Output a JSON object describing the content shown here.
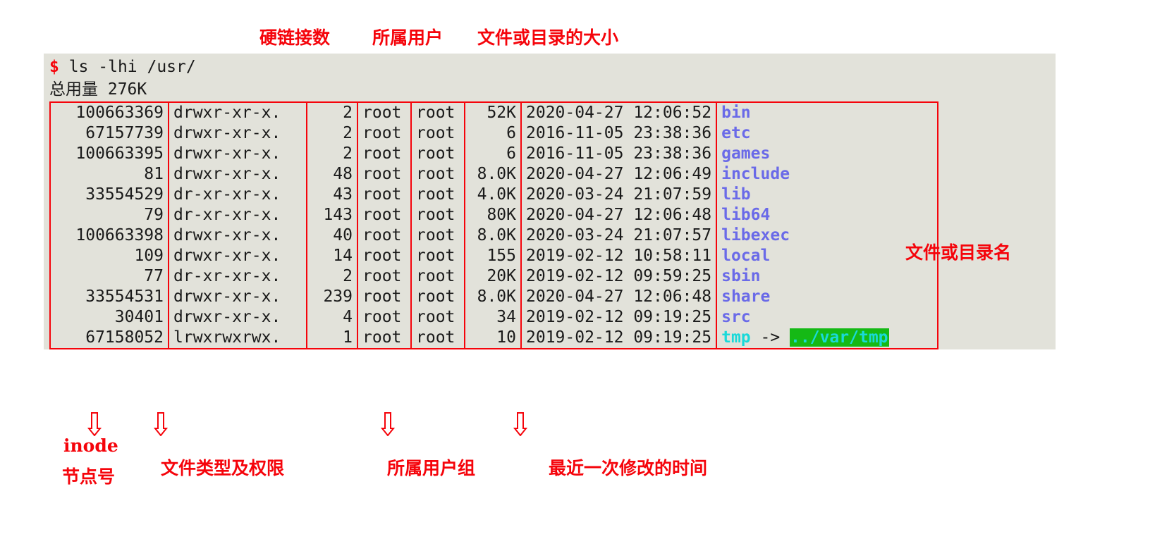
{
  "terminal": {
    "prompt_symbol": "$",
    "command": " ls -lhi /usr/",
    "total_line": "总用量 276K",
    "background": "#e2e2da",
    "border_color": "#f5040b"
  },
  "columns": [
    {
      "key": "inode",
      "label": "inode节点号"
    },
    {
      "key": "perm",
      "label": "文件类型及权限"
    },
    {
      "key": "links",
      "label": "硬链接数"
    },
    {
      "key": "user",
      "label": "所属用户"
    },
    {
      "key": "group",
      "label": "所属用户组"
    },
    {
      "key": "size",
      "label": "文件或目录的大小"
    },
    {
      "key": "time",
      "label": "最近一次修改的时间"
    },
    {
      "key": "name",
      "label": "文件或目录名"
    }
  ],
  "rows": [
    {
      "inode": "100663369",
      "perm": "drwxr-xr-x.",
      "links": "2",
      "user": "root",
      "group": "root",
      "size": "52K",
      "time": "2020-04-27 12:06:52",
      "name": "bin",
      "type": "dir",
      "link_arrow": "",
      "link_target": ""
    },
    {
      "inode": "67157739",
      "perm": "drwxr-xr-x.",
      "links": "2",
      "user": "root",
      "group": "root",
      "size": "6",
      "time": "2016-11-05 23:38:36",
      "name": "etc",
      "type": "dir",
      "link_arrow": "",
      "link_target": ""
    },
    {
      "inode": "100663395",
      "perm": "drwxr-xr-x.",
      "links": "2",
      "user": "root",
      "group": "root",
      "size": "6",
      "time": "2016-11-05 23:38:36",
      "name": "games",
      "type": "dir",
      "link_arrow": "",
      "link_target": ""
    },
    {
      "inode": "81",
      "perm": "drwxr-xr-x.",
      "links": "48",
      "user": "root",
      "group": "root",
      "size": "8.0K",
      "time": "2020-04-27 12:06:49",
      "name": "include",
      "type": "dir",
      "link_arrow": "",
      "link_target": ""
    },
    {
      "inode": "33554529",
      "perm": "dr-xr-xr-x.",
      "links": "43",
      "user": "root",
      "group": "root",
      "size": "4.0K",
      "time": "2020-03-24 21:07:59",
      "name": "lib",
      "type": "dir",
      "link_arrow": "",
      "link_target": ""
    },
    {
      "inode": "79",
      "perm": "dr-xr-xr-x.",
      "links": "143",
      "user": "root",
      "group": "root",
      "size": "80K",
      "time": "2020-04-27 12:06:48",
      "name": "lib64",
      "type": "dir",
      "link_arrow": "",
      "link_target": ""
    },
    {
      "inode": "100663398",
      "perm": "drwxr-xr-x.",
      "links": "40",
      "user": "root",
      "group": "root",
      "size": "8.0K",
      "time": "2020-03-24 21:07:57",
      "name": "libexec",
      "type": "dir",
      "link_arrow": "",
      "link_target": ""
    },
    {
      "inode": "109",
      "perm": "drwxr-xr-x.",
      "links": "14",
      "user": "root",
      "group": "root",
      "size": "155",
      "time": "2019-02-12 10:58:11",
      "name": "local",
      "type": "dir",
      "link_arrow": "",
      "link_target": ""
    },
    {
      "inode": "77",
      "perm": "dr-xr-xr-x.",
      "links": "2",
      "user": "root",
      "group": "root",
      "size": "20K",
      "time": "2019-02-12 09:59:25",
      "name": "sbin",
      "type": "dir",
      "link_arrow": "",
      "link_target": ""
    },
    {
      "inode": "33554531",
      "perm": "drwxr-xr-x.",
      "links": "239",
      "user": "root",
      "group": "root",
      "size": "8.0K",
      "time": "2020-04-27 12:06:48",
      "name": "share",
      "type": "dir",
      "link_arrow": "",
      "link_target": ""
    },
    {
      "inode": "30401",
      "perm": "drwxr-xr-x.",
      "links": "4",
      "user": "root",
      "group": "root",
      "size": "34",
      "time": "2019-02-12 09:19:25",
      "name": "src",
      "type": "dir",
      "link_arrow": "",
      "link_target": ""
    },
    {
      "inode": "67158052",
      "perm": "lrwxrwxrwx.",
      "links": "1",
      "user": "root",
      "group": "root",
      "size": "10",
      "time": "2019-02-12 09:19:25",
      "name": "tmp",
      "type": "link",
      "link_arrow": " -> ",
      "link_target": "../var/tmp"
    }
  ],
  "annotations": {
    "top": [
      {
        "id": "links",
        "text": "硬链接数"
      },
      {
        "id": "user",
        "text": "所属用户"
      },
      {
        "id": "size",
        "text": "文件或目录的大小"
      }
    ],
    "right": [
      {
        "id": "name",
        "text": "文件或目录名"
      }
    ],
    "bottom": [
      {
        "id": "inode_line1",
        "text": "inode"
      },
      {
        "id": "inode_line2",
        "text": "节点号"
      },
      {
        "id": "perm",
        "text": "文件类型及权限"
      },
      {
        "id": "group",
        "text": "所属用户组"
      },
      {
        "id": "time",
        "text": "最近一次修改的时间"
      }
    ],
    "color": "#f5040b"
  }
}
